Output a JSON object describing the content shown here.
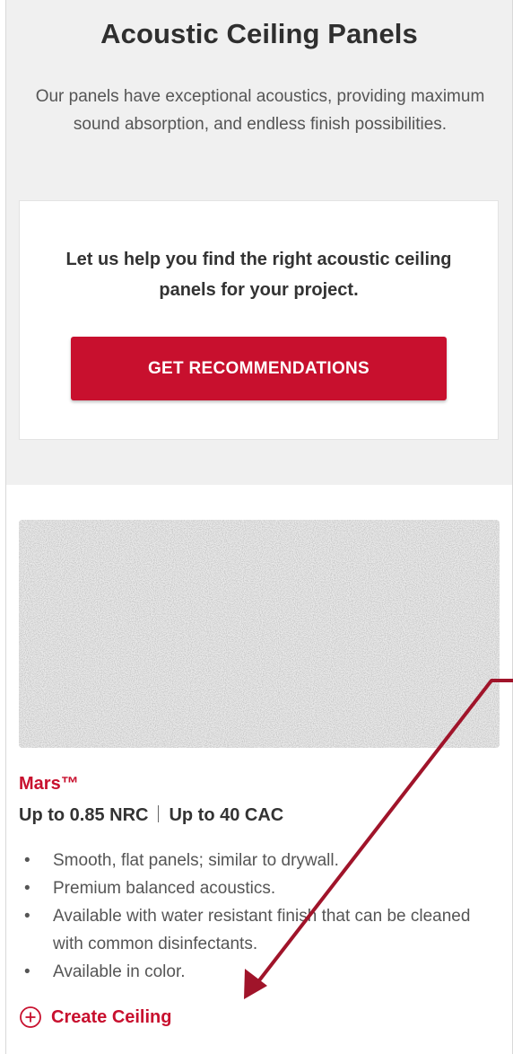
{
  "hero": {
    "title": "Acoustic Ceiling Panels",
    "description": "Our panels have exceptional acoustics, providing maximum sound absorption, and endless finish possibilities."
  },
  "recommendation": {
    "text": "Let us help you find the right acoustic ceiling panels for your project.",
    "button_label": "GET RECOMMENDATIONS"
  },
  "product": {
    "image_icon": "textured-ceiling-panel-swatch",
    "name": "Mars™",
    "nrc": "Up to 0.85 NRC",
    "cac": "Up to 40 CAC",
    "features": [
      "Smooth, flat panels; similar to drywall.",
      "Premium balanced acoustics.",
      "Available with water resistant finish that can be cleaned with common disinfectants.",
      "Available in color."
    ],
    "create_icon": "plus-circle-icon",
    "create_label": "Create Ceiling"
  },
  "colors": {
    "brand_red": "#c8102e",
    "hero_background": "#f0f0f0",
    "annotation_arrow": "#a0142a"
  }
}
